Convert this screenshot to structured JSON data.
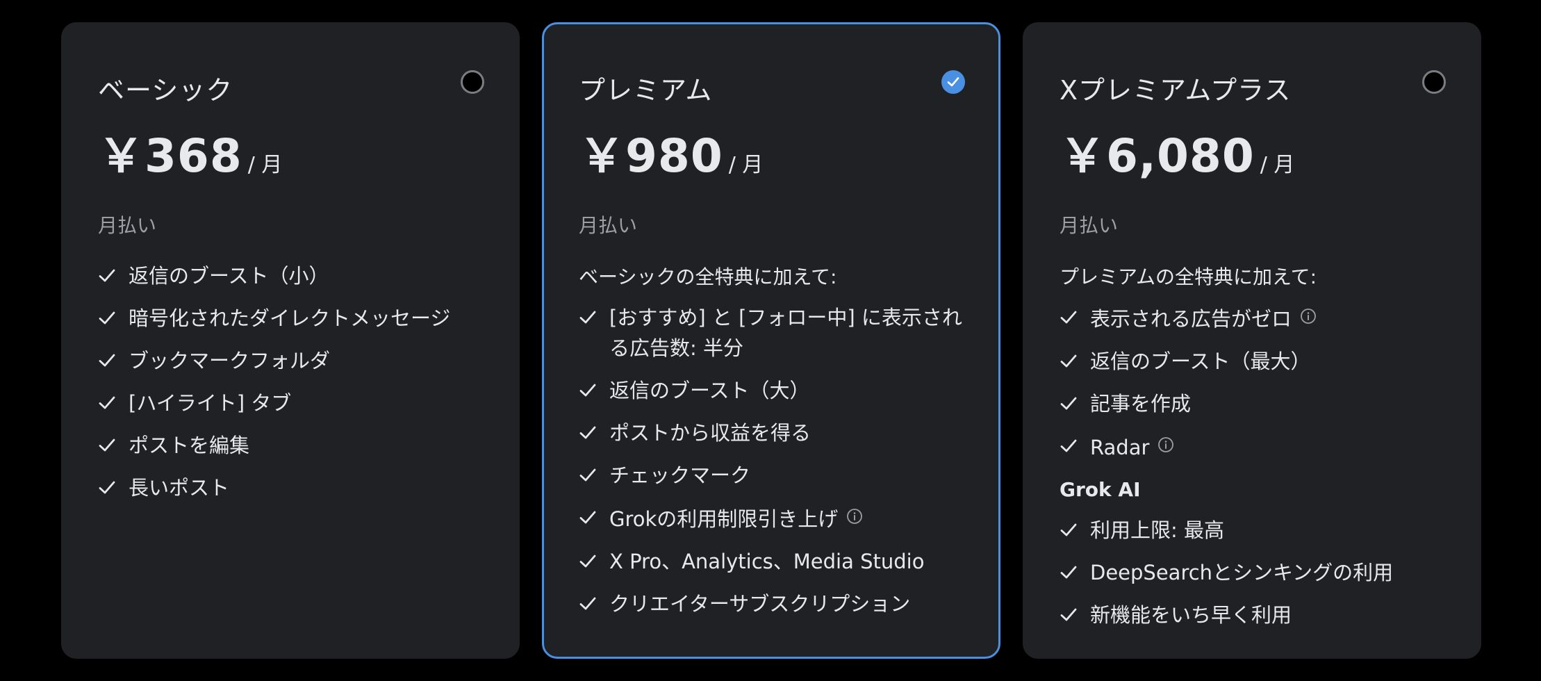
{
  "colors": {
    "background": "#000000",
    "card": "#202124",
    "accent": "#4a90e2",
    "text": "#e7e9ea",
    "muted": "#9aa0a6"
  },
  "plans": [
    {
      "name": "ベーシック",
      "price": "￥368",
      "per": "/ 月",
      "billing": "月払い",
      "selected": false,
      "features": [
        {
          "text": "返信のブースト（小）"
        },
        {
          "text": "暗号化されたダイレクトメッセージ"
        },
        {
          "text": "ブックマークフォルダ"
        },
        {
          "text": "[ハイライト] タブ"
        },
        {
          "text": "ポストを編集"
        },
        {
          "text": "長いポスト"
        }
      ]
    },
    {
      "name": "プレミアム",
      "price": "￥980",
      "per": "/ 月",
      "billing": "月払い",
      "selected": true,
      "intro": "ベーシックの全特典に加えて:",
      "features": [
        {
          "text": "[おすすめ] と [フォロー中] に表示される広告数: 半分"
        },
        {
          "text": "返信のブースト（大）"
        },
        {
          "text": "ポストから収益を得る"
        },
        {
          "text": "チェックマーク"
        },
        {
          "text": "Grokの利用制限引き上げ",
          "info": "info-icon"
        },
        {
          "text": "X Pro、Analytics、Media Studio"
        },
        {
          "text": "クリエイターサブスクリプション"
        }
      ]
    },
    {
      "name": "Xプレミアムプラス",
      "price": "￥6,080",
      "per": "/ 月",
      "billing": "月払い",
      "selected": false,
      "intro": "プレミアムの全特典に加えて:",
      "features": [
        {
          "text": "表示される広告がゼロ",
          "info": "info-icon"
        },
        {
          "text": "返信のブースト（最大）"
        },
        {
          "text": "記事を作成"
        },
        {
          "text": "Radar",
          "info": "info-icon"
        }
      ],
      "grok_heading": "Grok AI",
      "grok_features": [
        {
          "text": "利用上限: 最高"
        },
        {
          "text": "DeepSearchとシンキングの利用"
        },
        {
          "text": "新機能をいち早く利用"
        }
      ]
    }
  ]
}
